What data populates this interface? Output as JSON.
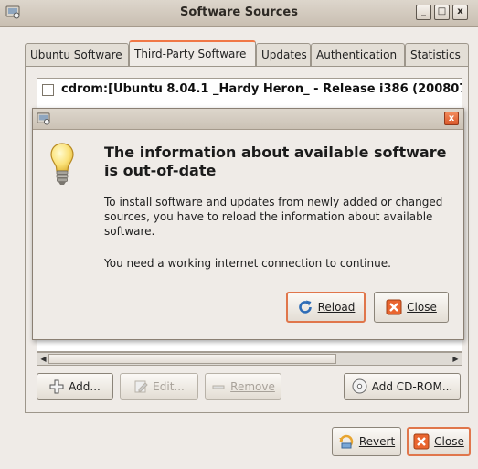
{
  "window": {
    "title": "Software Sources",
    "minimize": "_",
    "maximize": "□",
    "close": "x"
  },
  "tabs": [
    {
      "label": "Ubuntu Software"
    },
    {
      "label": "Third-Party Software"
    },
    {
      "label": "Updates"
    },
    {
      "label": "Authentication"
    },
    {
      "label": "Statistics"
    }
  ],
  "sources": [
    {
      "label": "cdrom:[Ubuntu 8.04.1 _Hardy Heron_ - Release i386 (200807",
      "checked": false
    }
  ],
  "source_buttons": {
    "add": "Add...",
    "edit": "Edit...",
    "remove": "Remove",
    "add_cdrom": "Add CD-ROM..."
  },
  "dialog": {
    "heading": "The information about available software is out-of-date",
    "body": "To install software and updates from newly added or changed sources, you have to reload the information about available software.",
    "body2": "You need a working internet connection to continue.",
    "reload": "Reload",
    "close": "Close",
    "close_x": "x"
  },
  "footer": {
    "revert": "Revert",
    "close": "Close"
  },
  "colors": {
    "accent": "#f07746",
    "window_bg": "#efebe7"
  }
}
